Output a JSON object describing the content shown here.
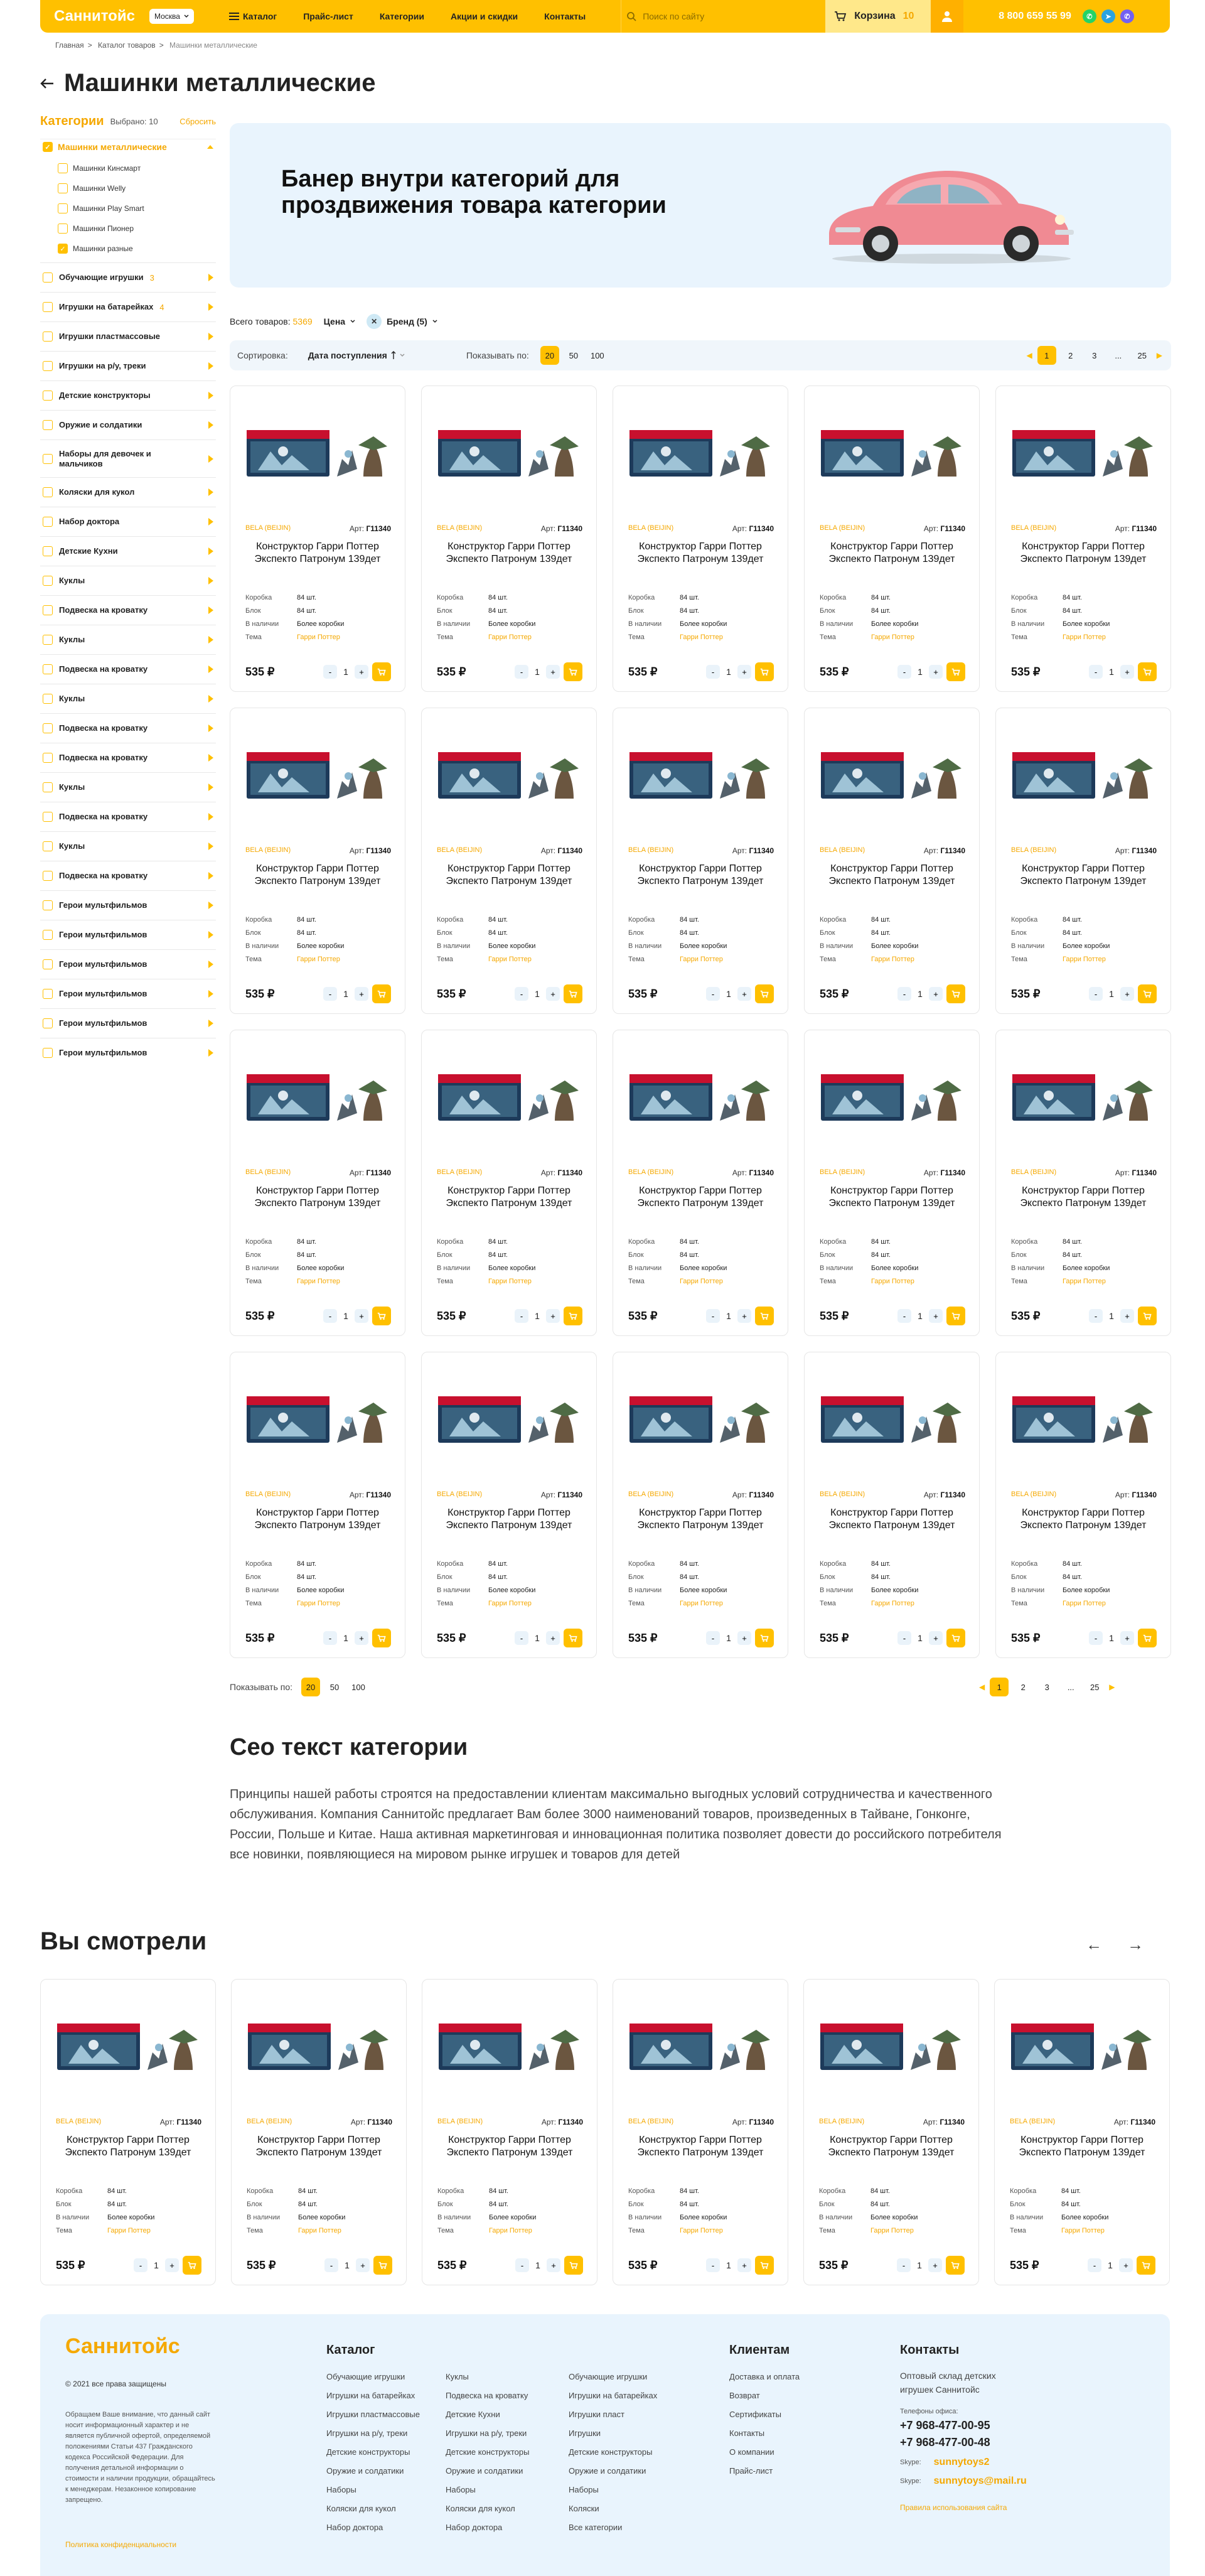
{
  "header": {
    "logo": "Саннитойс",
    "city": "Москва",
    "catalog": "Каталог",
    "nav": [
      "Прайс-лист",
      "Категории",
      "Акции и скидки",
      "Контакты"
    ],
    "search_placeholder": "Поиск по сайту",
    "cart_label": "Корзина",
    "cart_count": "10",
    "phone": "8 800 659 55 99"
  },
  "breadcrumbs": {
    "home": "Главная",
    "catalog": "Каталог товаров",
    "current": "Машинки металлические"
  },
  "page_title": "Машинки металлические",
  "sidebar": {
    "title": "Категории",
    "selected": "Выбрано: 10",
    "clear": "Сбросить",
    "open_category": "Машинки металлические",
    "sub": [
      {
        "label": "Машинки Кинсмарт",
        "checked": false
      },
      {
        "label": "Машинки Welly",
        "checked": false
      },
      {
        "label": "Машинки Play Smart",
        "checked": false
      },
      {
        "label": "Машинки Пионер",
        "checked": false
      },
      {
        "label": "Машинки разные",
        "checked": true
      }
    ],
    "cats": [
      {
        "label": "Обучающие игрушки",
        "count": "3"
      },
      {
        "label": "Игрушки на батарейках",
        "count": "4"
      },
      {
        "label": "Игрушки пластмассовые",
        "count": ""
      },
      {
        "label": "Игрушки на р/у, треки",
        "count": ""
      },
      {
        "label": "Детские конструкторы",
        "count": ""
      },
      {
        "label": "Оружие и солдатики",
        "count": ""
      },
      {
        "label": "Наборы для девочек и мальчиков",
        "count": ""
      },
      {
        "label": "Коляски для кукол",
        "count": ""
      },
      {
        "label": "Набор доктора",
        "count": ""
      },
      {
        "label": "Детские Кухни",
        "count": ""
      },
      {
        "label": "Куклы",
        "count": ""
      },
      {
        "label": "Подвеска на кроватку",
        "count": ""
      },
      {
        "label": "Куклы",
        "count": ""
      },
      {
        "label": "Подвеска на кроватку",
        "count": ""
      },
      {
        "label": "Куклы",
        "count": ""
      },
      {
        "label": "Подвеска на кроватку",
        "count": ""
      },
      {
        "label": "Подвеска на кроватку",
        "count": ""
      },
      {
        "label": "Куклы",
        "count": ""
      },
      {
        "label": "Подвеска на кроватку",
        "count": ""
      },
      {
        "label": "Куклы",
        "count": ""
      },
      {
        "label": "Подвеска на кроватку",
        "count": ""
      },
      {
        "label": "Герои мультфильмов",
        "count": ""
      },
      {
        "label": "Герои мультфильмов",
        "count": ""
      },
      {
        "label": "Герои мультфильмов",
        "count": ""
      },
      {
        "label": "Герои мультфильмов",
        "count": ""
      },
      {
        "label": "Герои мультфильмов",
        "count": ""
      },
      {
        "label": "Герои мультфильмов",
        "count": ""
      }
    ]
  },
  "banner": {
    "text": "Банер внутри категорий для проздвижения товара категории"
  },
  "filters": {
    "total_label": "Всего товаров:",
    "total": "5369",
    "price": "Цена",
    "brand_chip": "Бренд (5)"
  },
  "sortbar": {
    "sort_label": "Сортировка:",
    "sort_value": "Дата поступления",
    "per_page_label": "Показывать по:",
    "per_page": [
      "20",
      "50",
      "100"
    ],
    "pages": [
      "1",
      "2",
      "3",
      "...",
      "25"
    ]
  },
  "product": {
    "brand": "BELA (BEIJIN)",
    "art_label": "Арт:",
    "art": "Г11340",
    "name": "Конструктор Гарри Поттер Экспекто Патронум 139дет",
    "props": [
      {
        "k": "Коробка",
        "v": "84 шт."
      },
      {
        "k": "Блок",
        "v": "84 шт."
      },
      {
        "k": "В наличии",
        "v": "Более коробки"
      },
      {
        "k": "Тема",
        "v": "Гарри Поттер"
      }
    ],
    "price": "535 ₽",
    "qty": "1"
  },
  "products_count": 20,
  "seo": {
    "title": "Сео текст категории",
    "text": "Принципы нашей работы строятся на предоставлении клиентам максимально выгодных условий сотрудничества и качественного обслуживания. Компания Саннитойс предлагает Вам более 3000 наименований товаров, произведенных в Тайване, Гонконге, России, Польше и Китае. Наша активная маркетинговая и инновационная политика позволяет довести до российского потребителя все новинки, появляющиеся на мировом рынке игрушек и товаров для детей"
  },
  "viewed": {
    "title": "Вы смотрели",
    "count": 6
  },
  "footer": {
    "logo": "Саннитойс",
    "copyright": "© 2021 все права защищены",
    "note": "Обращаем Ваше внимание, что данный сайт носит информационный характер и не является публичной офертой, определяемой положениями Статьи 437 Гражданского кодекса Российской Федерации. Для получения детальной информации о стоимости и наличии продукции, обращайтесь к менеджерам. Незаконное копирование запрещено.",
    "privacy": "Политика конфиденциальности",
    "catalog_title": "Каталог",
    "catalog_col1": [
      "Обучающие игрушки",
      "Игрушки на батарейках",
      "Игрушки пластмассовые",
      "Игрушки на р/у, треки",
      "Детские конструкторы",
      "Оружие и солдатики",
      "Наборы",
      "Коляски для кукол",
      "Набор доктора"
    ],
    "catalog_col2": [
      "Куклы",
      "Подвеска на кроватку",
      "Детские Кухни",
      "Игрушки на р/у, треки",
      "Детские конструкторы",
      "Оружие и солдатики",
      "Наборы",
      "Коляски для кукол",
      "Набор доктора"
    ],
    "catalog_col3": [
      "Обучающие игрушки",
      "Игрушки на батарейках",
      "Игрушки пласт",
      "Игрушки",
      "Детские конструкторы",
      "Оружие и солдатики",
      "Наборы",
      "Коляски",
      "Все категории"
    ],
    "clients_title": "Клиентам",
    "clients": [
      "Доставка и оплата",
      "Возврат",
      "Сертификаты",
      "Контакты",
      "О компании",
      "Прайс-лист"
    ],
    "contacts_title": "Контакты",
    "contacts_desc": "Оптовый склад детских игрушек Саннитойс",
    "phones_label": "Телефоны офиса:",
    "phone1": "+7 968-477-00-95",
    "phone2": "+7 968-477-00-48",
    "skype_label": "Skype:",
    "skype": "sunnytoys2",
    "email": "sunnytoys@mail.ru",
    "policy": "Правила использования сайта"
  },
  "colors": {
    "accent": "#ffc000",
    "light_bg": "#e9f4fd"
  }
}
